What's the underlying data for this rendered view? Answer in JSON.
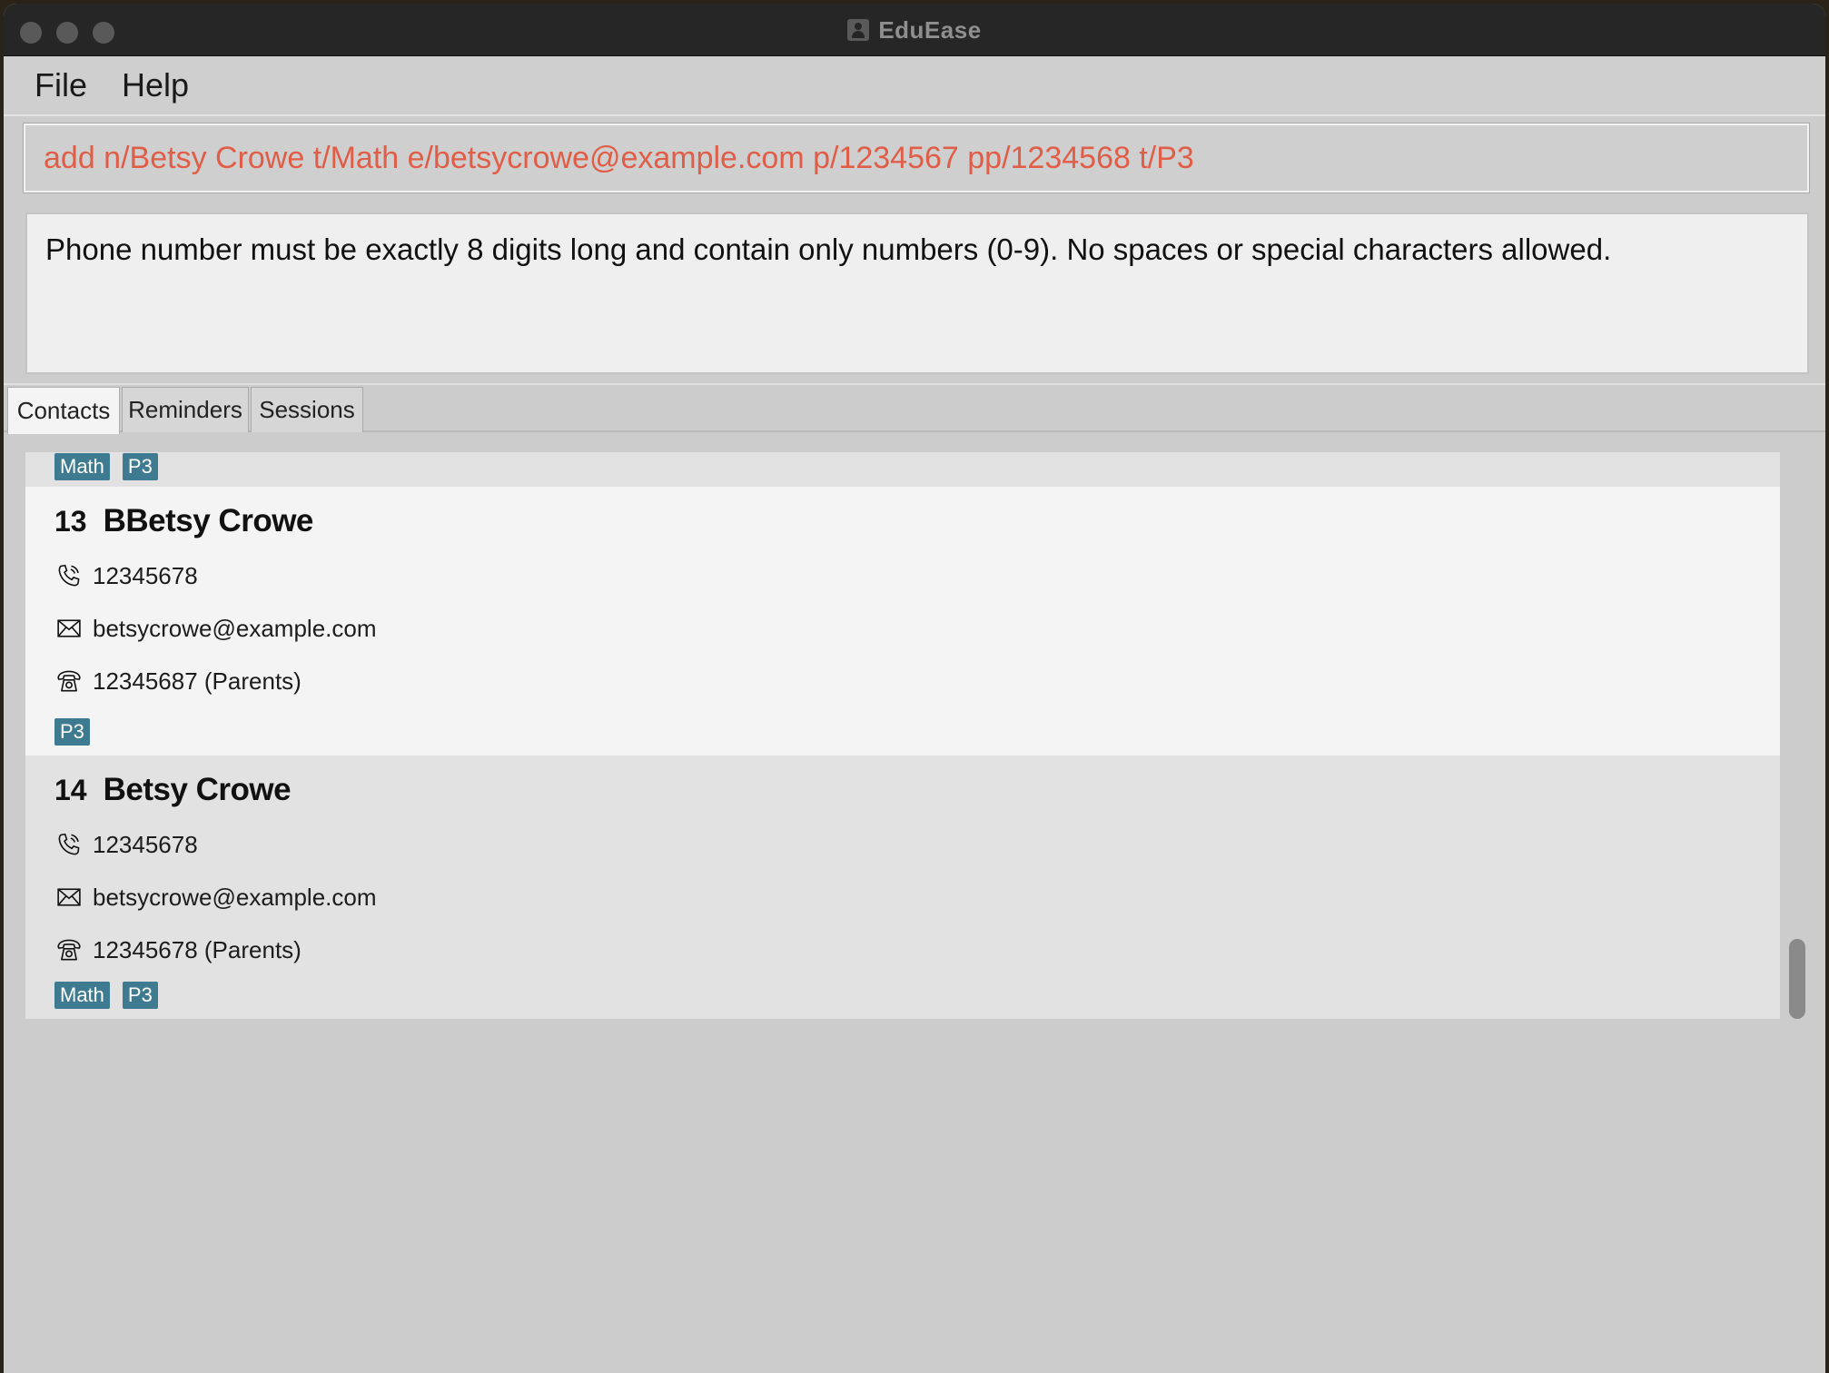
{
  "window": {
    "title": "EduEase"
  },
  "menu": {
    "items": [
      "File",
      "Help"
    ]
  },
  "command": {
    "value": "add n/Betsy Crowe t/Math e/betsycrowe@example.com p/1234567 pp/1234568 t/P3"
  },
  "result": {
    "message": "Phone number must be exactly 8 digits long and contain only numbers (0-9). No spaces or special characters allowed."
  },
  "tabs": [
    {
      "label": "Contacts",
      "active": true
    },
    {
      "label": "Reminders",
      "active": false
    },
    {
      "label": "Sessions",
      "active": false
    }
  ],
  "contacts": {
    "partial": {
      "tags": [
        "Math",
        "P3"
      ]
    },
    "items": [
      {
        "index": "13",
        "name": "BBetsy Crowe",
        "phone": "12345678",
        "email": "betsycrowe@example.com",
        "parent_phone": "12345687 (Parents)",
        "tags": [
          "P3"
        ]
      },
      {
        "index": "14",
        "name": "Betsy Crowe",
        "phone": "12345678",
        "email": "betsycrowe@example.com",
        "parent_phone": "12345678 (Parents)",
        "tags": [
          "Math",
          "P3"
        ]
      }
    ]
  },
  "colors": {
    "command_error_text": "#e05e48",
    "tag_background": "#3e7b91",
    "selected_card": "#f4f4f4",
    "card_background": "#e2e2e2"
  },
  "icons": {
    "phone": "phone-icon",
    "email": "envelope-icon",
    "parent_phone": "telephone-icon"
  }
}
